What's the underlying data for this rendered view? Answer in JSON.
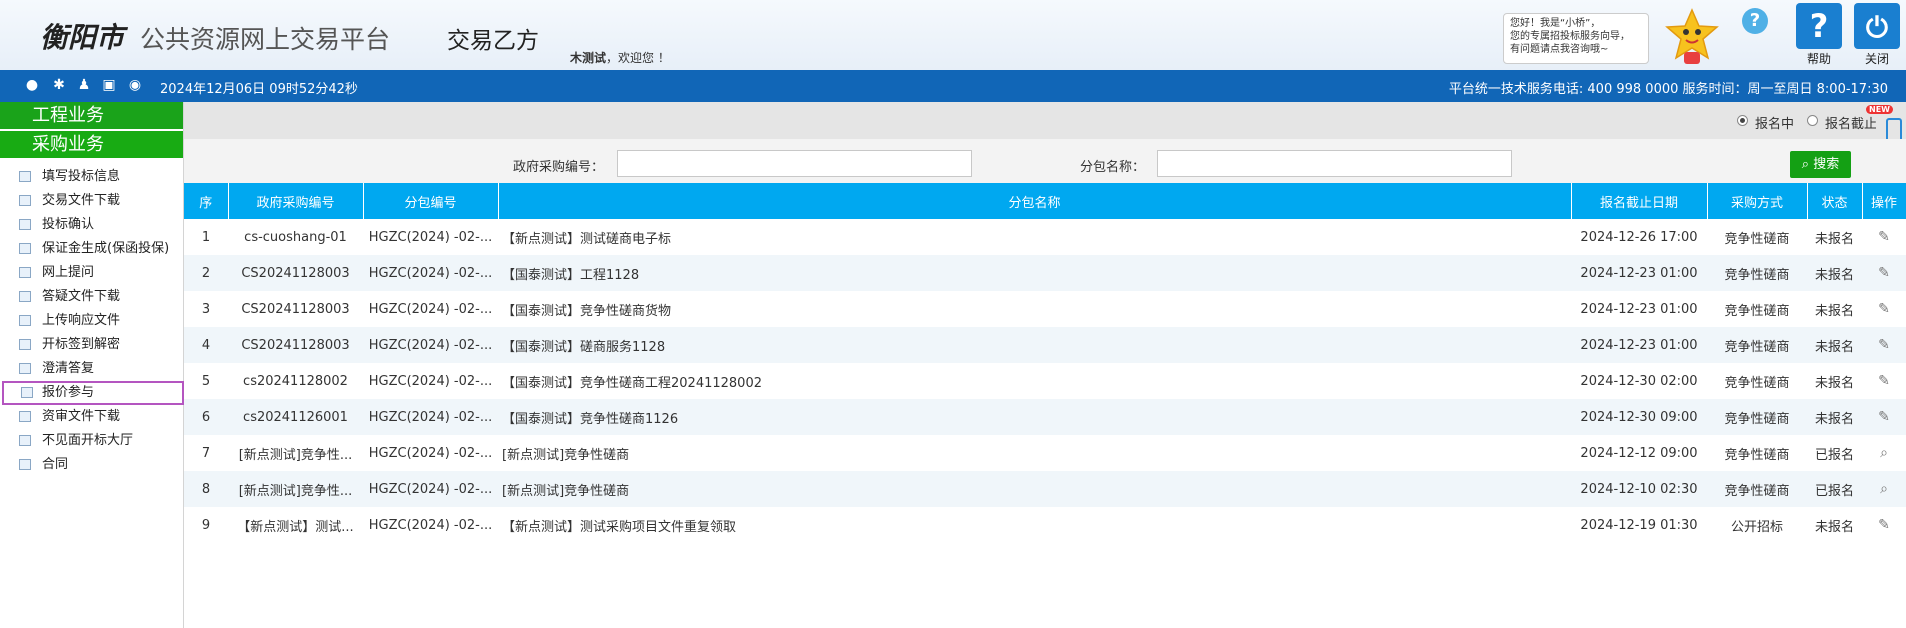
{
  "header": {
    "city": "衡阳市",
    "platform": "公共资源网上交易平台",
    "party": "交易乙方",
    "user": "木测试",
    "welcome": "，欢迎您 ！",
    "bubble": [
      "您好！我是“小桥”，",
      "您的专属招投标服务向导，",
      "有问题请点我咨询哦~"
    ],
    "help_label": "帮助",
    "close_label": "关闭"
  },
  "topbar": {
    "datetime": "2024年12月06日 09时52分42秒",
    "service": "平台统一技术服务电话: 400 998 0000 服务时间：周一至周日 8:00-17:30"
  },
  "sidebar": {
    "categories": [
      "工程业务",
      "采购业务"
    ],
    "items": [
      "填写投标信息",
      "交易文件下载",
      "投标确认",
      "保证金生成(保函投保)",
      "网上提问",
      "答疑文件下载",
      "上传响应文件",
      "开标签到解密",
      "澄清答复",
      "报价参与",
      "资审文件下载",
      "不见面开标大厅",
      "合同"
    ],
    "active_item": "报价参与"
  },
  "filter": {
    "radio1": "报名中",
    "radio2": "报名截止",
    "new_badge": "NEW"
  },
  "search": {
    "label1": "政府采购编号：",
    "label2": "分包名称：",
    "value1": "",
    "value2": "",
    "button": "搜索"
  },
  "table": {
    "headers": [
      "序",
      "政府采购编号",
      "分包编号",
      "分包名称",
      "报名截止日期",
      "采购方式",
      "状态",
      "操作"
    ],
    "rows": [
      {
        "no": "1",
        "code": "cs-cuoshang-01",
        "pkg": "HGZC(2024) -02-...",
        "name": "【新点测试】测试磋商电子标",
        "deadline": "2024-12-26 17:00",
        "method": "竞争性磋商",
        "status": "未报名",
        "op": "edit"
      },
      {
        "no": "2",
        "code": "CS20241128003",
        "pkg": "HGZC(2024) -02-...",
        "name": "【国泰测试】工程1128",
        "deadline": "2024-12-23 01:00",
        "method": "竞争性磋商",
        "status": "未报名",
        "op": "edit"
      },
      {
        "no": "3",
        "code": "CS20241128003",
        "pkg": "HGZC(2024) -02-...",
        "name": "【国泰测试】竞争性磋商货物",
        "deadline": "2024-12-23 01:00",
        "method": "竞争性磋商",
        "status": "未报名",
        "op": "edit"
      },
      {
        "no": "4",
        "code": "CS20241128003",
        "pkg": "HGZC(2024) -02-...",
        "name": "【国泰测试】磋商服务1128",
        "deadline": "2024-12-23 01:00",
        "method": "竞争性磋商",
        "status": "未报名",
        "op": "edit"
      },
      {
        "no": "5",
        "code": "cs20241128002",
        "pkg": "HGZC(2024) -02-...",
        "name": "【国泰测试】竞争性磋商工程20241128002",
        "deadline": "2024-12-30 02:00",
        "method": "竞争性磋商",
        "status": "未报名",
        "op": "edit"
      },
      {
        "no": "6",
        "code": "cs20241126001",
        "pkg": "HGZC(2024) -02-...",
        "name": "【国泰测试】竞争性磋商1126",
        "deadline": "2024-12-30 09:00",
        "method": "竞争性磋商",
        "status": "未报名",
        "op": "edit"
      },
      {
        "no": "7",
        "code": "[新点测试]竞争性...",
        "pkg": "HGZC(2024) -02-...",
        "name": "[新点测试]竞争性磋商",
        "deadline": "2024-12-12 09:00",
        "method": "竞争性磋商",
        "status": "已报名",
        "op": "view"
      },
      {
        "no": "8",
        "code": "[新点测试]竞争性...",
        "pkg": "HGZC(2024) -02-...",
        "name": "[新点测试]竞争性磋商",
        "deadline": "2024-12-10 02:30",
        "method": "竞争性磋商",
        "status": "已报名",
        "op": "view"
      },
      {
        "no": "9",
        "code": "【新点测试】测试...",
        "pkg": "HGZC(2024) -02-...",
        "name": "【新点测试】测试采购项目文件重复领取",
        "deadline": "2024-12-19 01:30",
        "method": "公开招标",
        "status": "未报名",
        "op": "edit"
      }
    ]
  },
  "colors": {
    "topbar": "#1166b7",
    "category": "#1aa31a",
    "table_header": "#00a8f0",
    "search_button": "#14a014",
    "active_outline": "#b455c0"
  }
}
